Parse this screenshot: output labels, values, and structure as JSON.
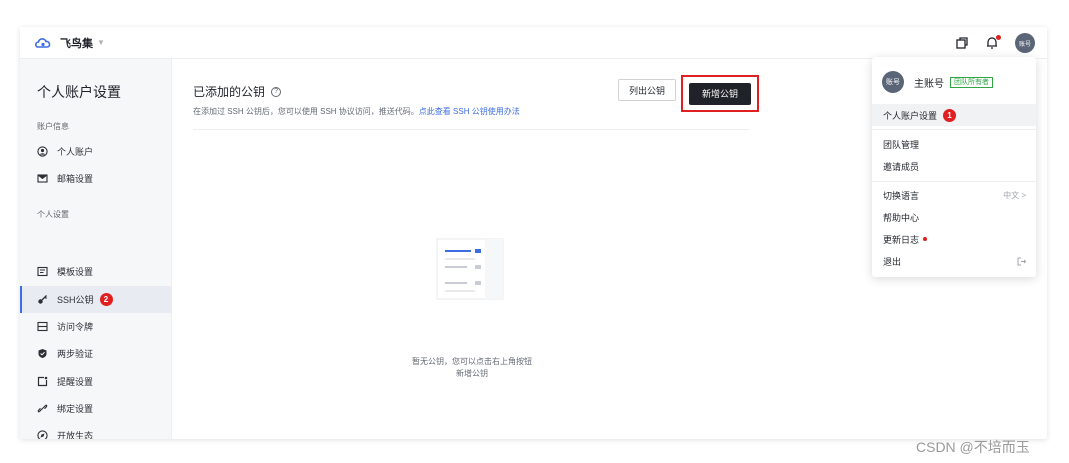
{
  "topbar": {
    "brand_name": "飞鸟集",
    "avatar_label": "账号"
  },
  "sidebar": {
    "title": "个人账户设置",
    "group1": "账户信息",
    "group2": "个人设置",
    "items": [
      {
        "label": "个人账户"
      },
      {
        "label": "邮箱设置"
      },
      {
        "label": "模板设置"
      },
      {
        "label": "SSH公钥",
        "badge": "2"
      },
      {
        "label": "访问令牌"
      },
      {
        "label": "两步验证"
      },
      {
        "label": "提醒设置"
      },
      {
        "label": "绑定设置"
      },
      {
        "label": "开放生态"
      }
    ]
  },
  "main": {
    "title": "已添加的公钥",
    "help": "?",
    "desc_text": "在添加过 SSH 公钥后，您可以使用 SSH 协议访问，推送代码。",
    "desc_link": "点此查看 SSH 公钥使用办法",
    "list_button": "列出公钥",
    "add_button": "新增公钥",
    "empty_line1": "暂无公钥，您可以点击右上角按钮",
    "empty_line2": "新增公钥"
  },
  "dropdown": {
    "avatar_label": "账号",
    "name": "主账号",
    "tag": "团队所有者",
    "items": [
      {
        "label": "个人账户设置",
        "badge": "1"
      },
      {
        "label": "团队管理"
      },
      {
        "label": "邀请成员"
      },
      {
        "label": "切换语言",
        "right": "中文 >"
      },
      {
        "label": "帮助中心"
      },
      {
        "label": "更新日志"
      },
      {
        "label": "退出"
      }
    ]
  },
  "watermark": "CSDN @不培而玉",
  "colors": {
    "accent": "#3d6de2",
    "primary_button": "#1f2329",
    "highlight": "#e02020",
    "tag": "#32a645"
  }
}
